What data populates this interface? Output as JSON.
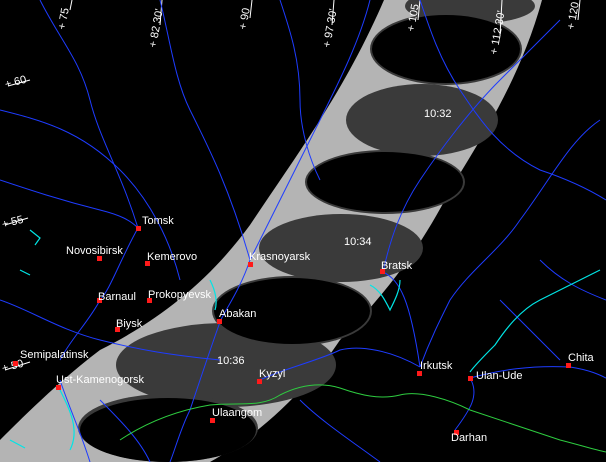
{
  "map": {
    "time_marks": [
      "10:32",
      "10:34",
      "10:36"
    ],
    "cities": [
      {
        "name": "Tomsk"
      },
      {
        "name": "Novosibirsk"
      },
      {
        "name": "Kemerovo"
      },
      {
        "name": "Krasnoyarsk"
      },
      {
        "name": "Bratsk"
      },
      {
        "name": "Barnaul"
      },
      {
        "name": "Prokopyevsk"
      },
      {
        "name": "Biysk"
      },
      {
        "name": "Abakan"
      },
      {
        "name": "Semipalatinsk"
      },
      {
        "name": "Ust-Kamenogorsk"
      },
      {
        "name": "Kyzyl"
      },
      {
        "name": "Ulaangom"
      },
      {
        "name": "Irkutsk"
      },
      {
        "name": "Ulan-Ude"
      },
      {
        "name": "Chita"
      },
      {
        "name": "Darhan"
      }
    ],
    "grid_labels": {
      "lon": [
        "+ 75",
        "+ 82 30'",
        "+ 90",
        "+ 97 30'",
        "+ 105",
        "+ 112 30'",
        "+ 120"
      ],
      "lat": [
        "+ 60",
        "+ 55",
        "+ 50"
      ]
    },
    "colors": {
      "background": "#000000",
      "rivers": "#1e3cff",
      "lakes": "#00e5e5",
      "borders": "#2ecc40",
      "path_band": "#b4b4b4",
      "umbra": "#3a3a3a",
      "city_marker": "#ff1a1a",
      "text": "#ffffff"
    }
  }
}
